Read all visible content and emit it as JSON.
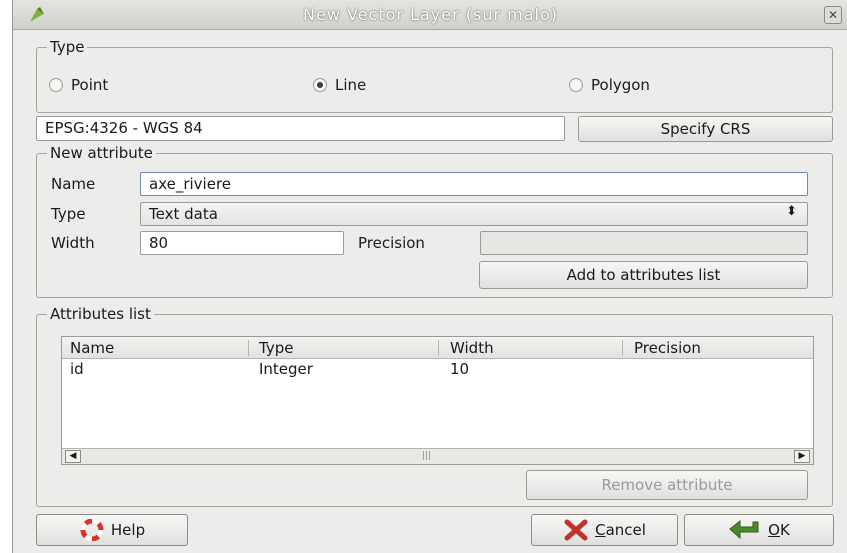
{
  "window": {
    "title": "New Vector Layer (sur malo)",
    "close_glyph": "✕",
    "icon": "qgis-icon"
  },
  "type_group": {
    "title": "Type",
    "options": [
      {
        "label": "Point",
        "selected": false
      },
      {
        "label": "Line",
        "selected": true
      },
      {
        "label": "Polygon",
        "selected": false
      }
    ]
  },
  "crs": {
    "value": "EPSG:4326 - WGS 84",
    "button_label": "Specify CRS"
  },
  "new_attribute": {
    "title": "New attribute",
    "name_label": "Name",
    "name_value": "axe_riviere",
    "type_label": "Type",
    "type_value": "Text data",
    "width_label": "Width",
    "width_value": "80",
    "precision_label": "Precision",
    "precision_value": "",
    "add_button": "Add to attributes list"
  },
  "attributes_list": {
    "title": "Attributes list",
    "columns": [
      "Name",
      "Type",
      "Width",
      "Precision"
    ],
    "rows": [
      {
        "name": "id",
        "type": "Integer",
        "width": "10",
        "precision": ""
      }
    ],
    "scroll_left": "◀",
    "scroll_right": "▶",
    "scroll_grip": "|||",
    "remove_button": "Remove attribute"
  },
  "footer": {
    "help_label": "Help",
    "cancel_label_first": "C",
    "cancel_label_rest": "ancel",
    "ok_label_first": "O",
    "ok_label_rest": "K"
  },
  "colors": {
    "background": "#ececea",
    "title_text": "#ffffff",
    "help_icon": "#d9322c",
    "cancel_icon": "#c4302b",
    "ok_icon": "#4a8a2a"
  }
}
